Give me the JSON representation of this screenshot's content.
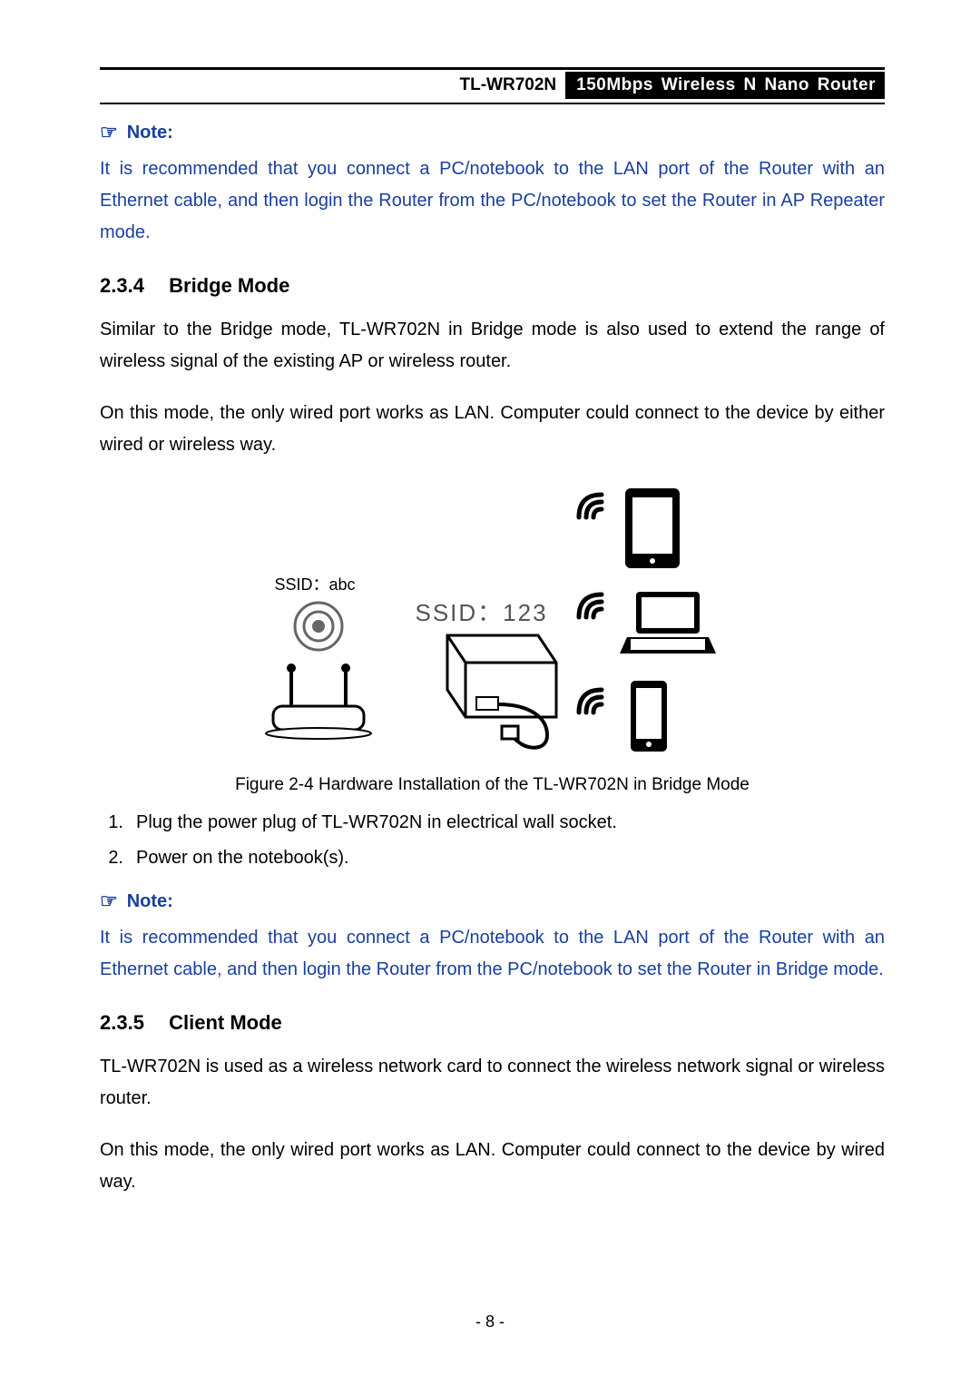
{
  "header": {
    "model": "TL-WR702N",
    "desc": "150Mbps Wireless N Nano Router"
  },
  "note1": {
    "label": "Note:",
    "text": "It is recommended that you connect a PC/notebook to the LAN port of the Router with an Ethernet cable, and then login the Router from the PC/notebook to set the Router in AP Repeater mode."
  },
  "sec234": {
    "num": "2.3.4",
    "title": "Bridge Mode",
    "p1": "Similar to the Bridge mode, TL-WR702N in Bridge mode is also used to extend the range of wireless signal of the existing AP or wireless router.",
    "p2": "On this mode, the only wired port works as LAN. Computer could connect to the device by either wired or wireless way."
  },
  "figure": {
    "ssid1": "SSID：abc",
    "ssid2": "SSID：123",
    "caption": "Figure 2-4 Hardware Installation of the TL-WR702N in Bridge Mode"
  },
  "steps": [
    {
      "n": "1.",
      "t": "Plug the power plug of TL-WR702N in electrical wall socket."
    },
    {
      "n": "2.",
      "t": "Power on the notebook(s)."
    }
  ],
  "note2": {
    "label": "Note:",
    "text": "It is recommended that you connect a PC/notebook to the LAN port of the Router with an Ethernet cable, and then login the Router from the PC/notebook to set the Router in Bridge mode."
  },
  "sec235": {
    "num": "2.3.5",
    "title": "Client Mode",
    "p1": "TL-WR702N is used as a wireless network card to connect the wireless network signal or wireless router.",
    "p2": "On this mode, the only wired port works as LAN. Computer could connect to the device by wired way."
  },
  "page_num": "- 8 -"
}
